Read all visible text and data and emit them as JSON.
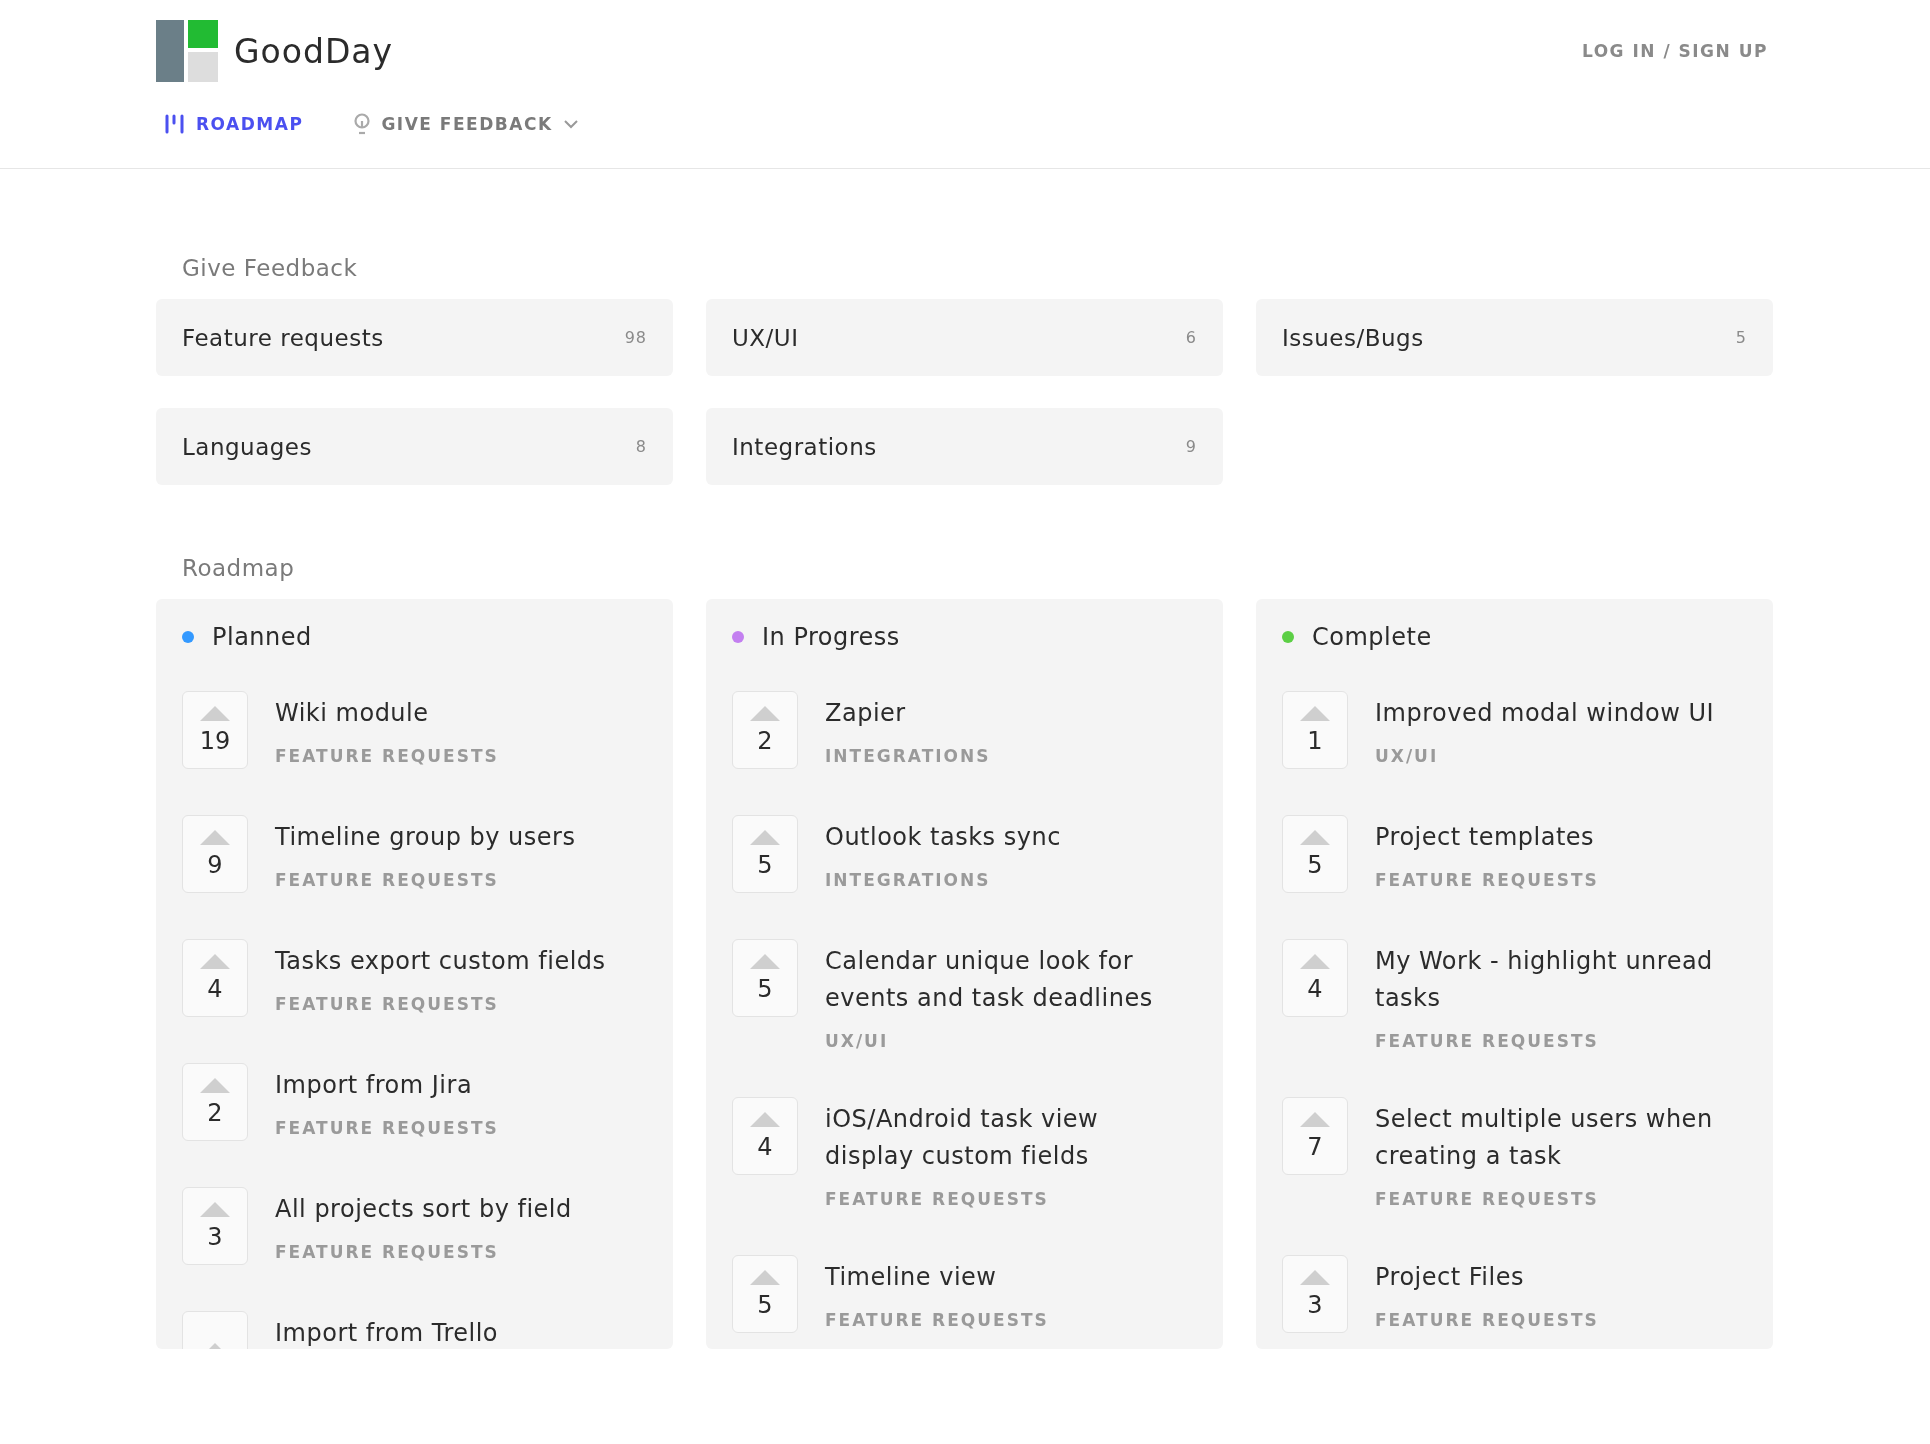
{
  "header": {
    "brand": "GoodDay",
    "auth_link": "LOG IN / SIGN UP",
    "nav": [
      {
        "label": "ROADMAP",
        "kind": "roadmap",
        "selected": true
      },
      {
        "label": "GIVE FEEDBACK",
        "kind": "feedback",
        "selected": false
      }
    ]
  },
  "feedback": {
    "title": "Give Feedback",
    "categories": [
      {
        "label": "Feature requests",
        "count": "98"
      },
      {
        "label": "UX/UI",
        "count": "6"
      },
      {
        "label": "Issues/Bugs",
        "count": "5"
      },
      {
        "label": "Languages",
        "count": "8"
      },
      {
        "label": "Integrations",
        "count": "9"
      }
    ]
  },
  "roadmap": {
    "title": "Roadmap",
    "columns": [
      {
        "name": "Planned",
        "color": "#3399ff",
        "items": [
          {
            "title": "Wiki module",
            "category": "FEATURE REQUESTS",
            "votes": "19"
          },
          {
            "title": "Timeline group by users",
            "category": "FEATURE REQUESTS",
            "votes": "9"
          },
          {
            "title": "Tasks export custom fields",
            "category": "FEATURE REQUESTS",
            "votes": "4"
          },
          {
            "title": "Import from Jira",
            "category": "FEATURE REQUESTS",
            "votes": "2"
          },
          {
            "title": "All projects sort by field",
            "category": "FEATURE REQUESTS",
            "votes": "3"
          },
          {
            "title": "Import from Trello"
          }
        ]
      },
      {
        "name": "In Progress",
        "color": "#c37ff0",
        "items": [
          {
            "title": "Zapier",
            "category": "INTEGRATIONS",
            "votes": "2"
          },
          {
            "title": "Outlook tasks sync",
            "category": "INTEGRATIONS",
            "votes": "5"
          },
          {
            "title": "Calendar unique look for events and task deadlines",
            "category": "UX/UI",
            "votes": "5"
          },
          {
            "title": "iOS/Android task view display custom fields",
            "category": "FEATURE REQUESTS",
            "votes": "4"
          },
          {
            "title": "Timeline view",
            "category": "FEATURE REQUESTS",
            "votes": "5"
          }
        ]
      },
      {
        "name": "Complete",
        "color": "#5ccf45",
        "items": [
          {
            "title": "Improved modal window UI",
            "category": "UX/UI",
            "votes": "1"
          },
          {
            "title": "Project templates",
            "category": "FEATURE REQUESTS",
            "votes": "5"
          },
          {
            "title": "My Work - highlight unread tasks",
            "category": "FEATURE REQUESTS",
            "votes": "4"
          },
          {
            "title": "Select multiple users when creating a task",
            "category": "FEATURE REQUESTS",
            "votes": "7"
          },
          {
            "title": "Project Files",
            "category": "FEATURE REQUESTS",
            "votes": "3"
          }
        ]
      }
    ]
  }
}
